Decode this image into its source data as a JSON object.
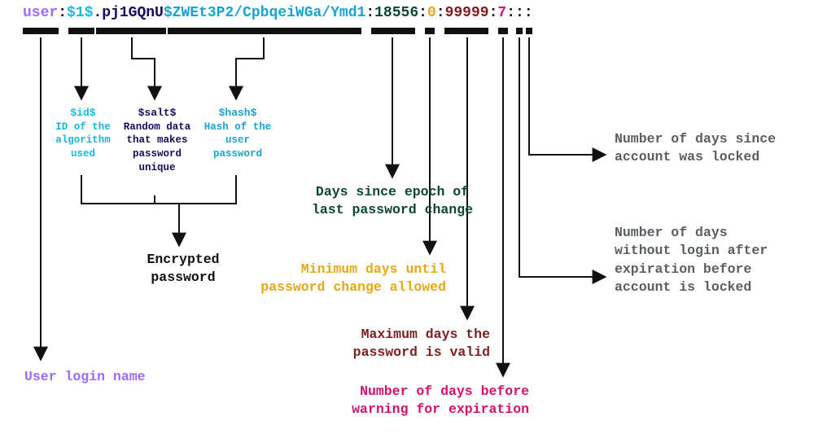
{
  "fields": {
    "user": "user",
    "id": "$1$",
    "salt": ".pj1GQnU",
    "hash": "$ZWEt3P2/CpbqeiWGa/Ymd1",
    "last_change_days": "18556",
    "min_days": "0",
    "max_days": "99999",
    "warn_days": "7"
  },
  "sep": ":",
  "sub_labels": {
    "id": {
      "title": "$id$",
      "desc": "ID of the algorithm used"
    },
    "salt": {
      "title": "$salt$",
      "desc": "Random data that makes password unique"
    },
    "hash": {
      "title": "$hash$",
      "desc": "Hash of the user password"
    }
  },
  "main_labels": {
    "user": "User login name",
    "enc": "Encrypted password",
    "days": "Days since epoch of last password change",
    "min": "Minimum days until password change allowed",
    "max": "Maximum days the password is valid",
    "warn": "Number of days before warning for expiration",
    "since": "Number of days since account was locked",
    "idle": "Number of days without login after expiration before account is locked"
  }
}
